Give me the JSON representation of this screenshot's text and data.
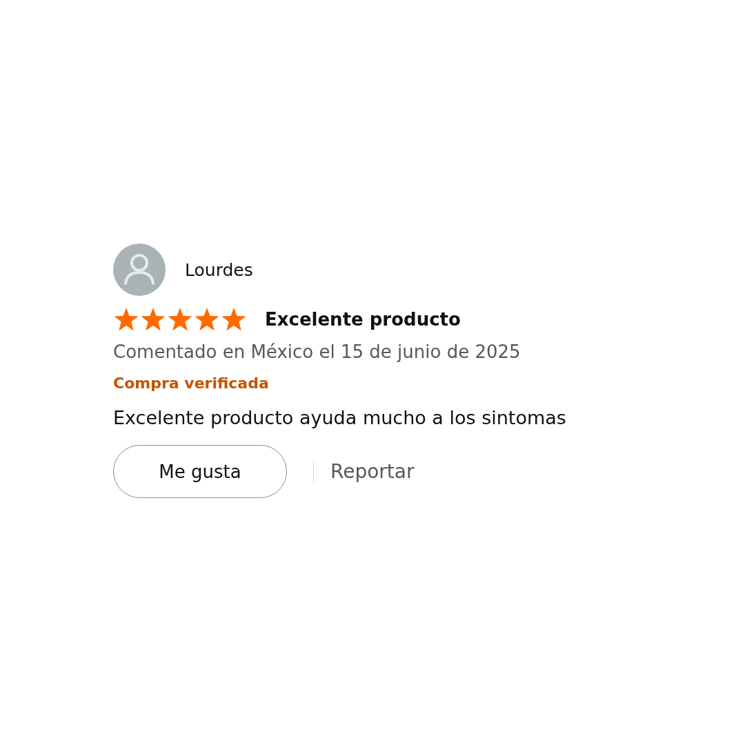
{
  "review": {
    "reviewer": "Lourdes",
    "stars": 5,
    "title": "Excelente producto",
    "meta": "Comentado en México el 15 de junio de 2025",
    "verified": "Compra verificada",
    "body": "Excelente producto ayuda mucho a los sintomas",
    "like_button": "Me gusta",
    "report_link": "Reportar"
  }
}
